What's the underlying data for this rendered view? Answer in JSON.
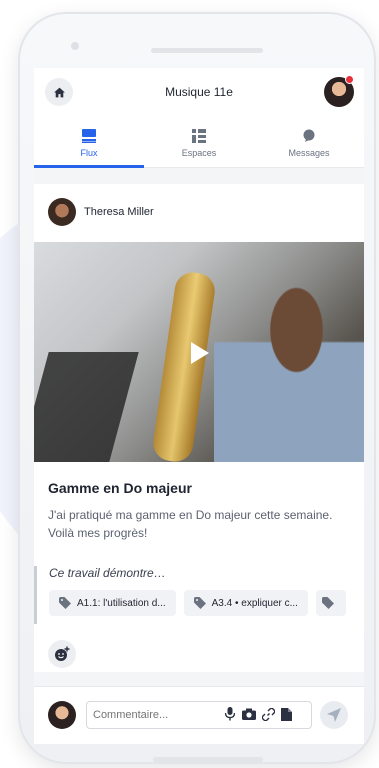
{
  "header": {
    "title": "Musique 11e"
  },
  "tabs": [
    {
      "label": "Flux",
      "icon": "feed-icon",
      "active": true
    },
    {
      "label": "Espaces",
      "icon": "spaces-icon",
      "active": false
    },
    {
      "label": "Messages",
      "icon": "chat-bubble-icon",
      "active": false
    }
  ],
  "post": {
    "author": "Theresa Miller",
    "title": "Gamme en Do majeur",
    "body": "J'ai pratiqué ma gamme en Do majeur cette semaine. Voilà mes progrès!",
    "proof_label": "Ce travail démontre…",
    "chips": [
      {
        "label": "A1.1: l'utilisation d...",
        "icon": "tag-icon"
      },
      {
        "label": "A3.4 • expliquer c...",
        "icon": "tag-icon"
      }
    ]
  },
  "comment": {
    "placeholder": "Commentaire..."
  },
  "colors": {
    "accent": "#2563eb",
    "notification": "#e8303b"
  }
}
